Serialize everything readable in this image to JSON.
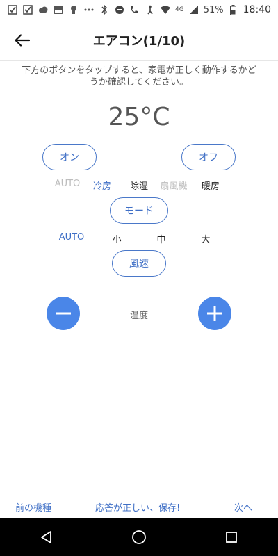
{
  "status_bar": {
    "time": "18:40",
    "battery": "51%",
    "network": "4G"
  },
  "header": {
    "title": "エアコン(1/10)"
  },
  "instruction": "下方のボタンをタップすると、家電が正しく動作するかどうか確認してください。",
  "temperature": "25°C",
  "buttons": {
    "on": "オン",
    "off": "オフ",
    "mode": "モード",
    "fan_speed": "風速"
  },
  "modes": [
    {
      "label": "AUTO",
      "state": "disabled"
    },
    {
      "label": "冷房",
      "state": "active"
    },
    {
      "label": "除湿",
      "state": "normal"
    },
    {
      "label": "扇風機",
      "state": "disabled"
    },
    {
      "label": "暖房",
      "state": "normal"
    }
  ],
  "fan_speeds": [
    {
      "label": "AUTO",
      "state": "active"
    },
    {
      "label": "小",
      "state": "normal"
    },
    {
      "label": "中",
      "state": "normal"
    },
    {
      "label": "大",
      "state": "normal"
    }
  ],
  "temp_control_label": "温度",
  "footer": {
    "prev": "前の機種",
    "confirm": "応答が正しい、保存!",
    "next": "次へ"
  },
  "colors": {
    "accent": "#4a78c9",
    "active_text": "#3f6fc6",
    "disabled_text": "#bdbdbd",
    "circle_button": "#4a86e8"
  },
  "icons": {
    "back": "arrow-left-icon",
    "minus": "minus-icon",
    "plus": "plus-icon"
  }
}
